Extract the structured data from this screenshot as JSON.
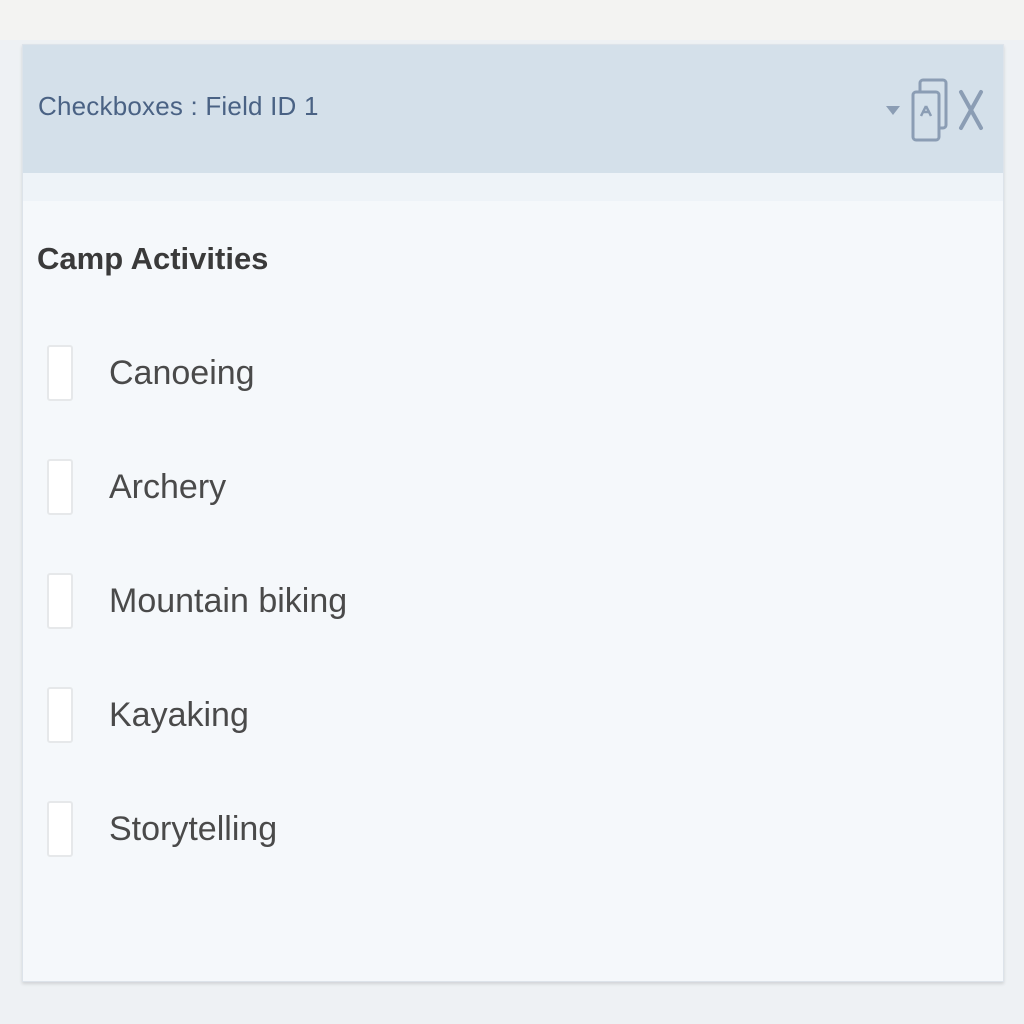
{
  "header": {
    "title": "Checkboxes : Field ID 1",
    "tools": {
      "toggle_icon": "caret-down-icon",
      "duplicate_icon": "duplicate-icon",
      "close_icon": "close-icon"
    }
  },
  "field": {
    "label": "Camp Activities",
    "choices": [
      {
        "label": "Canoeing",
        "checked": false
      },
      {
        "label": "Archery",
        "checked": false
      },
      {
        "label": "Mountain biking",
        "checked": false
      },
      {
        "label": "Kayaking",
        "checked": false
      },
      {
        "label": "Storytelling",
        "checked": false
      }
    ]
  },
  "colors": {
    "header_background": "#d4e0ea",
    "header_text": "#4a6284",
    "panel_background": "#f5f8fb",
    "icon_color": "#8b9db4"
  }
}
